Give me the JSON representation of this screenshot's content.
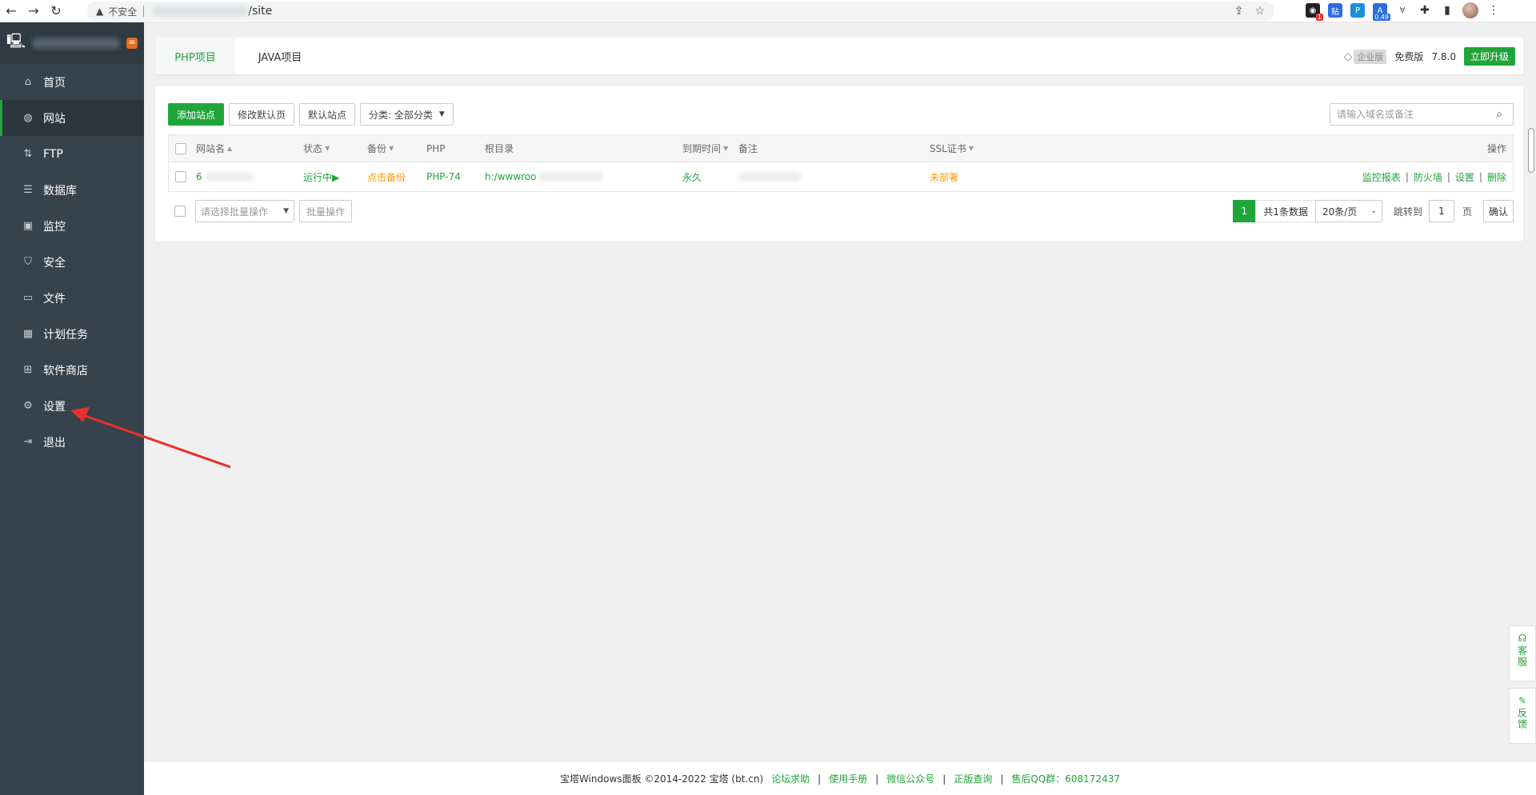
{
  "browser": {
    "insecure_label": "不安全",
    "url_path": "/site",
    "ext_badge_count": "1",
    "ext_tie": "贴",
    "ext_version": "0.49"
  },
  "sidebar": {
    "items": [
      {
        "label": "首页",
        "icon": "home-icon"
      },
      {
        "label": "网站",
        "icon": "globe-icon",
        "active": true
      },
      {
        "label": "FTP",
        "icon": "ftp-icon"
      },
      {
        "label": "数据库",
        "icon": "database-icon"
      },
      {
        "label": "监控",
        "icon": "monitor-icon"
      },
      {
        "label": "安全",
        "icon": "shield-icon"
      },
      {
        "label": "文件",
        "icon": "folder-icon"
      },
      {
        "label": "计划任务",
        "icon": "calendar-icon"
      },
      {
        "label": "软件商店",
        "icon": "grid-icon"
      },
      {
        "label": "设置",
        "icon": "gear-icon"
      },
      {
        "label": "退出",
        "icon": "logout-icon"
      }
    ]
  },
  "header": {
    "tabs": [
      {
        "label": "PHP项目",
        "active": true
      },
      {
        "label": "JAVA项目"
      }
    ],
    "enterprise_label": "企业版",
    "edition": "免费版",
    "version": "7.8.0",
    "upgrade_label": "立即升级"
  },
  "toolbar": {
    "add_site": "添加站点",
    "edit_default_page": "修改默认页",
    "default_site": "默认站点",
    "category": "分类: 全部分类",
    "search_placeholder": "请输入域名或备注"
  },
  "table": {
    "columns": {
      "site_name": "网站名",
      "status": "状态",
      "backup": "备份",
      "php": "PHP",
      "root": "根目录",
      "expire": "到期时间",
      "remark": "备注",
      "ssl": "SSL证书",
      "ops": "操作"
    },
    "rows": [
      {
        "site_name": "6",
        "status": "运行中▶",
        "backup": "点击备份",
        "php": "PHP-74",
        "root": "h:/wwwroo",
        "expire": "永久",
        "ssl": "未部署",
        "ops": [
          "监控报表",
          "防火墙",
          "设置",
          "删除"
        ]
      }
    ]
  },
  "bottom": {
    "batch_placeholder": "请选择批量操作",
    "batch_button": "批量操作",
    "page_current": "1",
    "total_text": "共1条数据",
    "per_page": "20条/页",
    "jump_label": "跳转到",
    "jump_value": "1",
    "page_unit": "页",
    "confirm": "确认"
  },
  "footer": {
    "copyright": "宝塔Windows面板 ©2014-2022 宝塔 (bt.cn)",
    "links": [
      "论坛求助",
      "使用手册",
      "微信公众号",
      "正版查询",
      "售后QQ群：608172437"
    ]
  },
  "helpers": {
    "service": "客服",
    "feedback": "反馈"
  },
  "colors": {
    "accent": "#20a53a",
    "warning": "#ff9800",
    "sidebar_bg": "#36424c"
  }
}
